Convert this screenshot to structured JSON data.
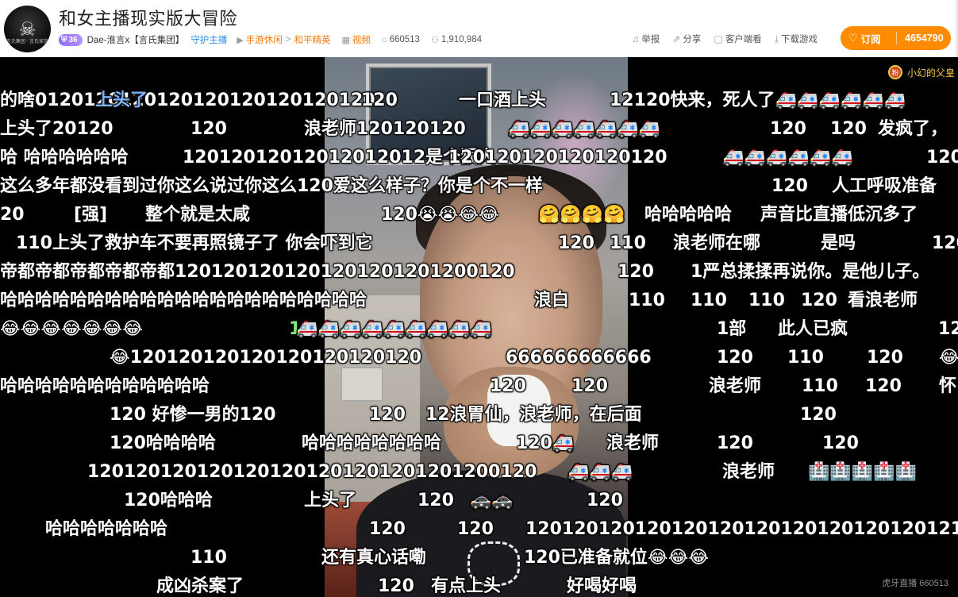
{
  "header": {
    "title": "和女主播现实版大冒险",
    "level": "36",
    "host_name": "Dae-淮言x【言氏集团】",
    "guard_label": "守护主播",
    "category_parent": "手游休闲",
    "category_sep": ">",
    "category_child": "和平精英",
    "video_label": "视频",
    "room_id": "660513",
    "subscribers": "1,910,984",
    "report_label": "举报",
    "share_label": "分享",
    "client_label": "客户端看",
    "download_label": "下载游戏",
    "subscribe_label": "订阅",
    "subscribe_count": "4654790",
    "avatar_text": "言氏集团 · 言氏家族"
  },
  "player": {
    "top_right_name": "小幻的父皇",
    "watermark": "虎牙直播 660513",
    "colors": {
      "accent": "#ff8c00",
      "guard": "#2b8ce8",
      "category": "#f4770a",
      "level_badge": "#8d6cf5"
    },
    "danmaku": [
      {
        "text": "的啥0120120120120120120120120120",
        "color": "white"
      },
      {
        "text": "上头了",
        "color": "blue"
      },
      {
        "text": "120",
        "color": "white"
      },
      {
        "text": "一口酒上头",
        "color": "white"
      },
      {
        "text": "12120快来，死人了🚑🚑🚑🚑🚑🚑",
        "color": "white"
      },
      {
        "text": "上头了20120",
        "color": "white"
      },
      {
        "text": "120",
        "color": "white"
      },
      {
        "text": "浪老师120120120",
        "color": "white"
      },
      {
        "text": "🚑🚑🚑🚑🚑🚑🚑",
        "color": "white"
      },
      {
        "text": "120",
        "color": "white"
      },
      {
        "text": "120",
        "color": "white"
      },
      {
        "text": "发疯了，",
        "color": "white"
      },
      {
        "text": "哈  哈哈哈哈哈哈",
        "color": "white"
      },
      {
        "text": "12012012012012012012是个狠人",
        "color": "white"
      },
      {
        "text": "120120120120120120",
        "color": "white"
      },
      {
        "text": "🚑🚑🚑🚑🚑🚑",
        "color": "white"
      },
      {
        "text": "120",
        "color": "white"
      },
      {
        "text": "这么多年都没看到过你这么说过你这么120爱这么样子？你是个不一样",
        "color": "white"
      },
      {
        "text": "120",
        "color": "white"
      },
      {
        "text": "人工呼吸准备",
        "color": "white"
      },
      {
        "text": "20",
        "color": "white"
      },
      {
        "text": "[强]",
        "color": "white"
      },
      {
        "text": "整个就是太咸",
        "color": "white"
      },
      {
        "text": "120😭😭😂😂",
        "color": "white"
      },
      {
        "text": "🤗🤗🤗🤗",
        "color": "white"
      },
      {
        "text": "哈哈哈哈哈",
        "color": "white"
      },
      {
        "text": "声音比直播低沉多了",
        "color": "white"
      },
      {
        "text": "110上头了救护车不要再照镜子了 你会吓到它",
        "color": "white"
      },
      {
        "text": "120",
        "color": "white"
      },
      {
        "text": "110",
        "color": "white"
      },
      {
        "text": "浪老师在哪",
        "color": "white"
      },
      {
        "text": "是吗",
        "color": "white"
      },
      {
        "text": "120",
        "color": "white"
      },
      {
        "text": "帝都帝都帝都帝都帝都1201201201201201201201200120",
        "color": "white"
      },
      {
        "text": "120",
        "color": "white"
      },
      {
        "text": "1严总揉揉再说你。是他儿子。",
        "color": "white"
      },
      {
        "text": "哈哈哈哈哈哈哈哈哈哈哈哈哈哈哈哈哈哈哈哈哈",
        "color": "white"
      },
      {
        "text": "浪白",
        "color": "white"
      },
      {
        "text": "110",
        "color": "white"
      },
      {
        "text": "110",
        "color": "white"
      },
      {
        "text": "110",
        "color": "white"
      },
      {
        "text": "120",
        "color": "white"
      },
      {
        "text": "看浪老师",
        "color": "white"
      },
      {
        "text": "😂😂😂😂😂😂😂",
        "color": "white"
      },
      {
        "text": "1",
        "color": "green"
      },
      {
        "text": "🚑🚑🚑🚑🚑🚑🚑🚑🚑",
        "color": "white"
      },
      {
        "text": "1部",
        "color": "white"
      },
      {
        "text": "此人已疯",
        "color": "white"
      },
      {
        "text": "12",
        "color": "white"
      },
      {
        "text": "😂120120120120120120120120",
        "color": "white"
      },
      {
        "text": "666666666666",
        "color": "white"
      },
      {
        "text": "120",
        "color": "white"
      },
      {
        "text": "110",
        "color": "white"
      },
      {
        "text": "120",
        "color": "white"
      },
      {
        "text": "😂",
        "color": "white"
      },
      {
        "text": "哈哈哈哈哈哈哈哈哈哈哈哈",
        "color": "white"
      },
      {
        "text": "120",
        "color": "white"
      },
      {
        "text": "120",
        "color": "white"
      },
      {
        "text": "浪老师",
        "color": "white"
      },
      {
        "text": "110",
        "color": "white"
      },
      {
        "text": "120",
        "color": "white"
      },
      {
        "text": "怀",
        "color": "white"
      },
      {
        "text": "120  好惨一男的120",
        "color": "white"
      },
      {
        "text": "120",
        "color": "white"
      },
      {
        "text": "12浪胃仙，浪老师，在后面",
        "color": "white"
      },
      {
        "text": "120",
        "color": "white"
      },
      {
        "text": "120哈哈哈哈",
        "color": "white"
      },
      {
        "text": "哈哈哈哈哈哈哈哈",
        "color": "white"
      },
      {
        "text": "120🚑",
        "color": "white"
      },
      {
        "text": "浪老师",
        "color": "white"
      },
      {
        "text": "120",
        "color": "white"
      },
      {
        "text": "120",
        "color": "white"
      },
      {
        "text": "1201201201201201201201201201201200120",
        "color": "white"
      },
      {
        "text": "🚑🚑🚑",
        "color": "white"
      },
      {
        "text": "浪老师",
        "color": "white"
      },
      {
        "text": "🏥🏥🏥🏥🏥",
        "color": "white"
      },
      {
        "text": "120哈哈哈",
        "color": "white"
      },
      {
        "text": "上头了",
        "color": "white"
      },
      {
        "text": "120",
        "color": "white"
      },
      {
        "text": "🚓🚓",
        "color": "white"
      },
      {
        "text": "120",
        "color": "white"
      },
      {
        "text": "哈哈哈哈哈哈哈",
        "color": "white"
      },
      {
        "text": "120",
        "color": "white"
      },
      {
        "text": "120",
        "color": "white"
      },
      {
        "text": "12012012012012012012012012012012012120",
        "color": "white"
      },
      {
        "text": "110",
        "color": "white"
      },
      {
        "text": "还有真心话嘞",
        "color": "white"
      },
      {
        "text": "120已准备就位😂😂😂",
        "color": "white"
      },
      {
        "text": "成凶杀案了",
        "color": "white"
      },
      {
        "text": "120",
        "color": "white"
      },
      {
        "text": "有点上头",
        "color": "white"
      },
      {
        "text": "好喝好喝",
        "color": "white"
      }
    ]
  }
}
